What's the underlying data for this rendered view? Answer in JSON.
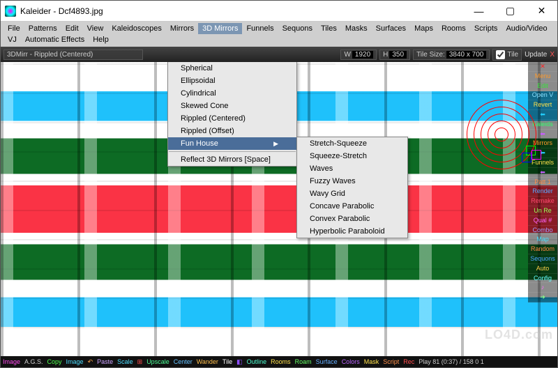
{
  "window": {
    "title": "Kaleider - Dcf4893.jpg"
  },
  "wincontrols": {
    "min": "—",
    "max": "▢",
    "close": "✕"
  },
  "menubar": [
    "File",
    "Patterns",
    "Edit",
    "View",
    "Kaleidoscopes",
    "Mirrors",
    "3D Mirrors",
    "Funnels",
    "Sequons",
    "Tiles",
    "Masks",
    "Surfaces",
    "Maps",
    "Rooms",
    "Scripts",
    "Audio/Video",
    "VJ",
    "Automatic Effects",
    "Help"
  ],
  "menubar_open_index": 6,
  "toolbar": {
    "fx_label": "3DMirr - Rippled (Centered)",
    "w_label": "W",
    "w_val": "1920",
    "h_label": "H",
    "h_val": "350",
    "tilesize_label": "Tile Size:",
    "tilesize_val": "3840 x 700",
    "tile_checkbox_label": "Tile",
    "update_label": "Update",
    "x_label": "X"
  },
  "dropdown1": {
    "items": [
      {
        "label": "Spherical"
      },
      {
        "label": "Ellipsoidal"
      },
      {
        "label": "Cylindrical"
      },
      {
        "label": "Skewed Cone"
      },
      {
        "label": "Rippled (Centered)"
      },
      {
        "label": "Rippled (Offset)"
      },
      {
        "label": "Fun House",
        "highlight": true,
        "arrow": true
      }
    ],
    "after_sep": {
      "label": "Reflect 3D Mirrors  [Space]"
    }
  },
  "dropdown2": {
    "items": [
      "Stretch-Squeeze",
      "Squeeze-Stretch",
      "Waves",
      "Fuzzy Waves",
      "Wavy Grid",
      "Concave Parabolic",
      "Convex Parabolic",
      "Hyperbolic Paraboloid"
    ]
  },
  "right_panel": [
    {
      "t": "✕",
      "c": "#ff2222"
    },
    {
      "t": "Menu",
      "c": "#ff9a2a"
    },
    {
      "t": "Edit",
      "c": "#35e23a"
    },
    {
      "t": "Open V",
      "c": "#8be0ff"
    },
    {
      "t": "Revert",
      "c": "#ffe14a"
    },
    {
      "t": "⬅",
      "c": "#23d0ff"
    },
    {
      "t": "Kaleids",
      "c": "#2cff6b"
    },
    {
      "t": "⬅",
      "c": "#c75cff"
    },
    {
      "t": "Mirrors",
      "c": "#ff9a2a"
    },
    {
      "t": "⬅",
      "c": "#23d0ff"
    },
    {
      "t": "Funnels",
      "c": "#ffe14a"
    },
    {
      "t": "⬅",
      "c": "#c75cff"
    },
    {
      "t": "Patt 1",
      "c": "#ff8c4a"
    },
    {
      "t": "Render",
      "c": "#59a9ff"
    },
    {
      "t": "Remake",
      "c": "#ff4a6e"
    },
    {
      "t": "Un   Re",
      "c": "#9cff5a"
    },
    {
      "t": "Qual #",
      "c": "#ff66ff"
    },
    {
      "t": "Combo",
      "c": "#a0a0ff"
    },
    {
      "t": "Map",
      "c": "#4adfff"
    },
    {
      "t": "Random",
      "c": "#ff8547"
    },
    {
      "t": "Sequons",
      "c": "#4aa3ff"
    },
    {
      "t": "Auto",
      "c": "#ffd24a"
    },
    {
      "t": "Config",
      "c": "#66ffff"
    },
    {
      "t": "♪",
      "c": "#ff6fff"
    },
    {
      "t": "➔",
      "c": "#8cff8c"
    }
  ],
  "bottom_bar": [
    {
      "t": "Image",
      "c": "#ff4af0"
    },
    {
      "t": "A.G.S.",
      "c": "#d0d0d0"
    },
    {
      "t": "Copy",
      "c": "#4dff4d"
    },
    {
      "t": "Image",
      "c": "#4dddff"
    },
    {
      "t": "↶",
      "c": "#ffa64d"
    },
    {
      "t": "Paste",
      "c": "#cda4ff"
    },
    {
      "t": "Scale",
      "c": "#4dddff"
    },
    {
      "t": "⊞",
      "c": "#ff4d4d"
    },
    {
      "t": "Upscale",
      "c": "#4dff97"
    },
    {
      "t": "Center",
      "c": "#66c2ff"
    },
    {
      "t": "Wander",
      "c": "#ffbf4d"
    },
    {
      "t": "Tile",
      "c": "#ffffff"
    },
    {
      "t": "◧",
      "c": "#8d4dff"
    },
    {
      "t": "Outline",
      "c": "#4dffd1"
    },
    {
      "t": "Rooms",
      "c": "#ffe24d"
    },
    {
      "t": "Roam",
      "c": "#66ff66"
    },
    {
      "t": "Surface",
      "c": "#66afff"
    },
    {
      "t": "Colors",
      "c": "#bb66ff"
    },
    {
      "t": "Mask",
      "c": "#ffe24d"
    },
    {
      "t": "Script",
      "c": "#ff914d"
    },
    {
      "t": "Rec",
      "c": "#ff4d4d"
    },
    {
      "t": "Play 81 (0:37) / 158 0 1",
      "c": "#cfcfcf"
    }
  ],
  "watermark": "LO4D.com"
}
